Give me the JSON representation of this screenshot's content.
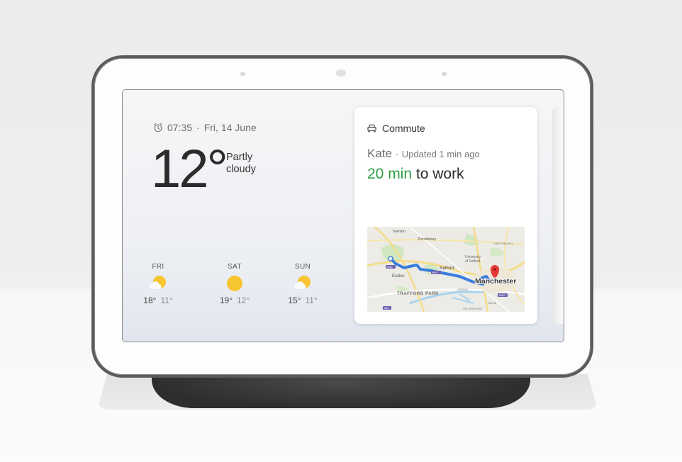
{
  "device": {
    "name": "Smart display"
  },
  "status": {
    "time": "07:35",
    "separator": "·",
    "date": "Fri, 14 June",
    "alarm_icon": "alarm-clock-icon"
  },
  "weather": {
    "temperature": "12°",
    "condition_line1": "Partly",
    "condition_line2": "cloudy",
    "forecast": [
      {
        "day": "FRI",
        "icon": "partly-cloudy-icon",
        "high": "18°",
        "low": "11°"
      },
      {
        "day": "SAT",
        "icon": "sunny-icon",
        "high": "19°",
        "low": "12°"
      },
      {
        "day": "SUN",
        "icon": "partly-cloudy-icon",
        "high": "15°",
        "low": "11°"
      }
    ]
  },
  "commute": {
    "icon": "car-icon",
    "title": "Commute",
    "person": "Kate",
    "separator": "·",
    "updated": "Updated 1 min ago",
    "eta_value": "20 min",
    "eta_suffix": "to work",
    "colors": {
      "eta": "#2e9e44",
      "route": "#3b7ddd",
      "pin": "#e53935"
    },
    "map": {
      "labels": {
        "swinton": "Swinton",
        "pendlebury": "Pendlebury",
        "university": "University",
        "of_salford": "of Salford",
        "salford": "Salford",
        "eccles": "Eccles",
        "trafford_park": "TRAFFORD PARK",
        "manchester": "Manchester",
        "cheetham_hill": "CHEETHAM HILL",
        "ordsall": "ORDSALL",
        "hulme": "HULME",
        "old_trafford": "OLD TRAFFORD",
        "m602_a": "M602",
        "m602_b": "M602",
        "m60": "M60",
        "a5063": "A5063"
      }
    }
  }
}
